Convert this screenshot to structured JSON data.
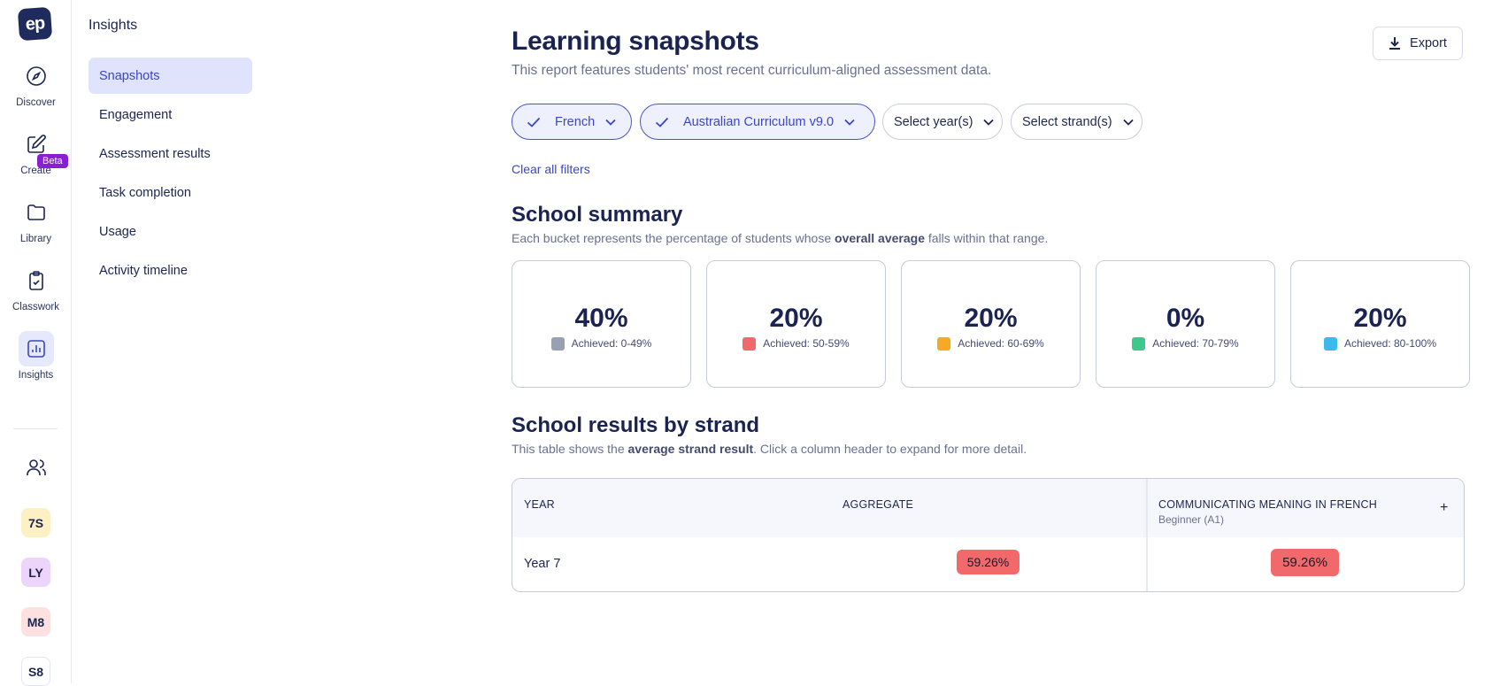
{
  "rail": {
    "logo": "ep",
    "items": [
      {
        "label": "Discover",
        "icon": "compass-icon"
      },
      {
        "label": "Create",
        "icon": "edit-icon"
      },
      {
        "label": "Library",
        "icon": "folder-icon"
      },
      {
        "label": "Classwork",
        "icon": "clipboard-check-icon"
      },
      {
        "label": "Insights",
        "icon": "bar-chart-icon"
      }
    ],
    "beta": "Beta",
    "classes": [
      {
        "label": "7S",
        "color": "#fdf0c4"
      },
      {
        "label": "LY",
        "color": "#ecd4fb"
      },
      {
        "label": "M8",
        "color": "#fde0e0"
      },
      {
        "label": "S8",
        "color": "#ffffff"
      }
    ]
  },
  "subnav": {
    "title": "Insights",
    "items": [
      "Snapshots",
      "Engagement",
      "Assessment results",
      "Task completion",
      "Usage",
      "Activity timeline"
    ]
  },
  "header": {
    "title": "Learning snapshots",
    "subtitle": "This report features students' most recent curriculum-aligned assessment data.",
    "export_label": "Export"
  },
  "filters": [
    {
      "label": "French",
      "selected": true
    },
    {
      "label": "Australian Curriculum v9.0",
      "selected": true
    },
    {
      "label": "Select year(s)",
      "selected": false
    },
    {
      "label": "Select strand(s)",
      "selected": false
    }
  ],
  "clear_filters": "Clear all filters",
  "summary": {
    "title": "School summary",
    "subtitle_pre": "Each bucket represents the percentage of students whose ",
    "subtitle_bold": "overall average",
    "subtitle_post": " falls within that range.",
    "buckets": [
      {
        "pct": "40%",
        "label": "Achieved: 0-49%",
        "color": "#9aa0b4"
      },
      {
        "pct": "20%",
        "label": "Achieved: 50-59%",
        "color": "#f2696b"
      },
      {
        "pct": "20%",
        "label": "Achieved: 60-69%",
        "color": "#f7a824"
      },
      {
        "pct": "0%",
        "label": "Achieved: 70-79%",
        "color": "#3ec98a"
      },
      {
        "pct": "20%",
        "label": "Achieved: 80-100%",
        "color": "#3bb8ec"
      }
    ]
  },
  "strand": {
    "title": "School results by strand",
    "subtitle_pre": "This table shows the ",
    "subtitle_bold": "average strand result",
    "subtitle_post": ". Click a column header to expand for more detail.",
    "columns": {
      "year": "YEAR",
      "aggregate": "AGGREGATE",
      "strand": "COMMUNICATING MEANING IN FRENCH",
      "strand_sub": "Beginner (A1)",
      "expand": "+"
    },
    "rows": [
      {
        "year": "Year 7",
        "aggregate": "59.26%",
        "strand": "59.26%"
      }
    ]
  }
}
